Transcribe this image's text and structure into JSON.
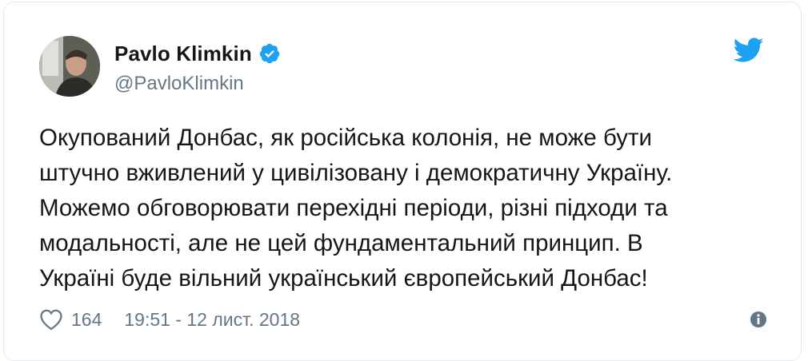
{
  "author": {
    "name": "Pavlo Klimkin",
    "handle": "@PavloKlimkin",
    "verified": true
  },
  "icons": {
    "verified": "verified-badge-icon",
    "brand": "twitter-bird-icon",
    "like": "heart-icon",
    "info": "info-icon"
  },
  "colors": {
    "brand": "#1da1f2",
    "text": "#14171a",
    "secondary": "#657786"
  },
  "tweet": {
    "text": "Окупований Донбас, як російська колонія, не може бути\nштучно вживлений у цивілізовану і демократичну Україну.\nМожемо обговорювати перехідні періоди, різні підходи та\nмодальності, але не цей фундаментальний принцип. В\nУкраїні буде вільний український європейський Донбас!"
  },
  "footer": {
    "likes": "164",
    "timestamp": "19:51 - 12 лист. 2018"
  }
}
